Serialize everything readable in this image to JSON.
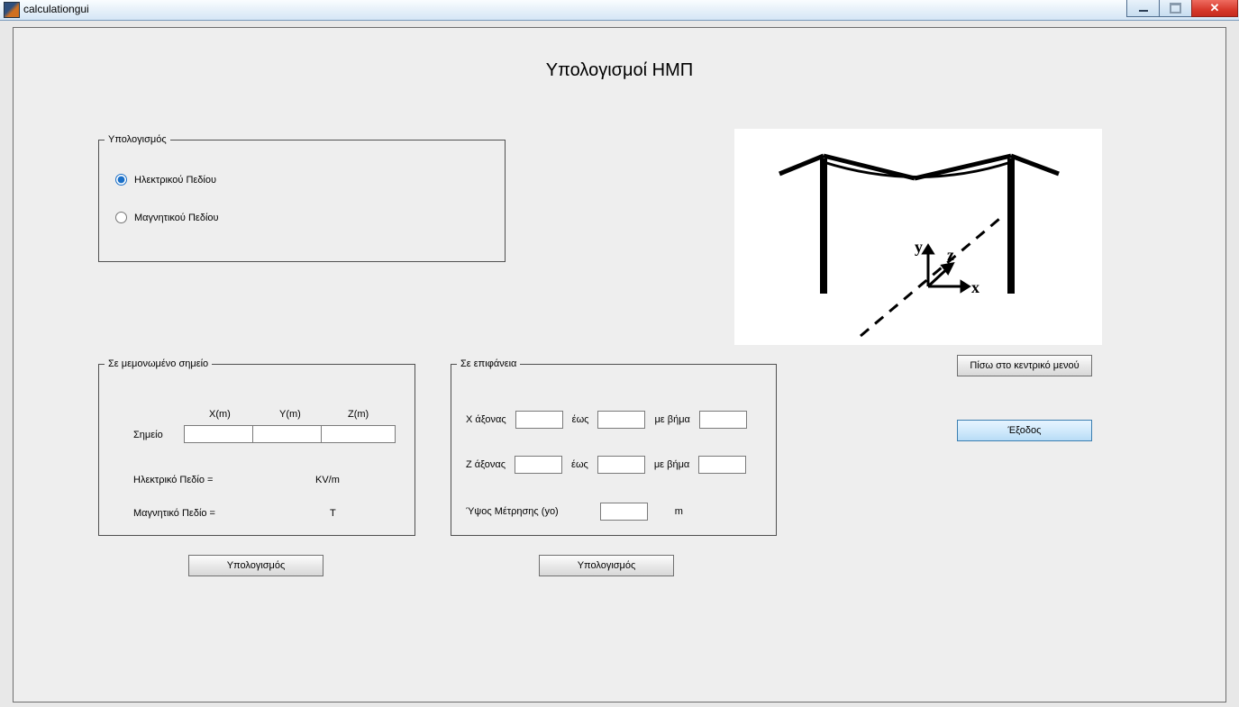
{
  "window": {
    "title": "calculationgui"
  },
  "page_title": "Υπολογισμοί ΗΜΠ",
  "calc_group": {
    "legend": "Υπολογισμός",
    "opt_electric": "Ηλεκτρικού Πεδίου",
    "opt_magnetic": "Μαγνητικού Πεδίου"
  },
  "point_group": {
    "legend": "Σε μεμονωμένο σημείο",
    "hdr_x": "X(m)",
    "hdr_y": "Y(m)",
    "hdr_z": "Z(m)",
    "lbl_point": "Σημείο",
    "val_x": "",
    "val_y": "",
    "val_z": "",
    "label_e": "Ηλεκτρικό Πεδίο =",
    "unit_e": "KV/m",
    "label_b": "Μαγνητικό Πεδίο =",
    "unit_b": "T"
  },
  "surf_group": {
    "legend": "Σε επιφάνεια",
    "label_x": "Χ άξονας",
    "label_z": "Ζ άξονας",
    "label_to": "έως",
    "label_step": "με βήμα",
    "label_y0": "Ύψος Μέτρησης (yo)",
    "unit_m": "m",
    "x_from": "",
    "x_to": "",
    "x_step": "",
    "z_from": "",
    "z_to": "",
    "z_step": "",
    "y0": ""
  },
  "buttons": {
    "calculate": "Υπολογισμός",
    "back_menu": "Πίσω στο κεντρικό μενού",
    "exit": "Έξοδος"
  },
  "diagram_labels": {
    "x": "x",
    "y": "y",
    "z": "z"
  }
}
